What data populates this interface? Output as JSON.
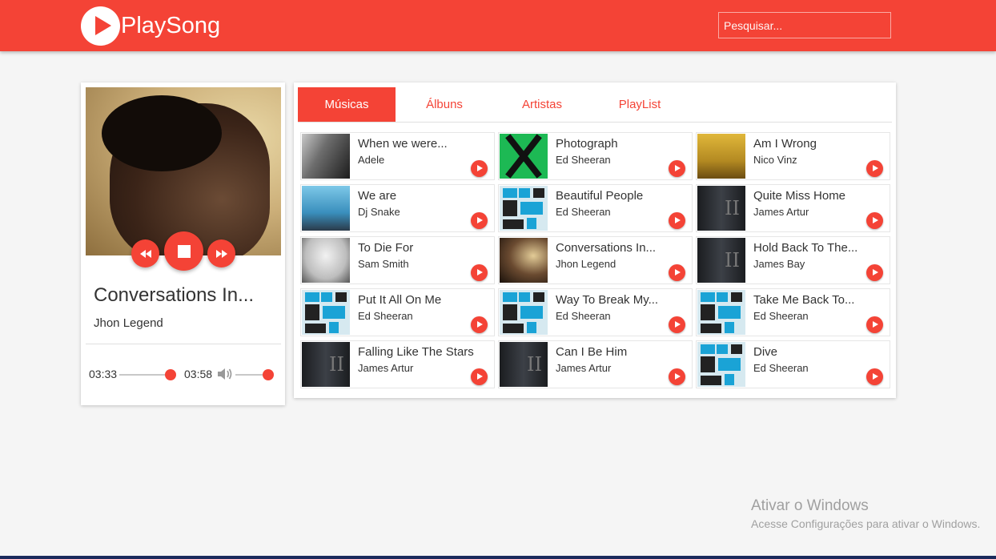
{
  "app": {
    "name": "PlaySong"
  },
  "search": {
    "placeholder": "Pesquisar..."
  },
  "player": {
    "title": "Conversations In...",
    "artist": "Jhon Legend",
    "current_time": "03:33",
    "total_time": "03:58",
    "progress_fraction": 0.89,
    "volume_fraction": 1.0
  },
  "tabs": [
    {
      "label": "Músicas",
      "active": true
    },
    {
      "label": "Álbuns",
      "active": false
    },
    {
      "label": "Artistas",
      "active": false
    },
    {
      "label": "PlayList",
      "active": false
    }
  ],
  "songs": [
    {
      "title": "When we were...",
      "artist": "Adele",
      "thumb": "adele"
    },
    {
      "title": "Photograph",
      "artist": "Ed Sheeran",
      "thumb": "x"
    },
    {
      "title": "Am I Wrong",
      "artist": "Nico Vinz",
      "thumb": "nico"
    },
    {
      "title": "We are",
      "artist": "Dj Snake",
      "thumb": "dj"
    },
    {
      "title": "Beautiful People",
      "artist": "Ed Sheeran",
      "thumb": "divide"
    },
    {
      "title": "Quite Miss Home",
      "artist": "James Artur",
      "thumb": "james"
    },
    {
      "title": "To Die For",
      "artist": "Sam Smith",
      "thumb": "sam"
    },
    {
      "title": "Conversations In...",
      "artist": "Jhon Legend",
      "thumb": "jhon"
    },
    {
      "title": "Hold Back To The...",
      "artist": "James Bay",
      "thumb": "james"
    },
    {
      "title": "Put It All On Me",
      "artist": "Ed Sheeran",
      "thumb": "divide"
    },
    {
      "title": "Way To Break My...",
      "artist": "Ed Sheeran",
      "thumb": "divide"
    },
    {
      "title": "Take Me Back To...",
      "artist": "Ed Sheeran",
      "thumb": "divide"
    },
    {
      "title": "Falling Like The Stars",
      "artist": "James Artur",
      "thumb": "james"
    },
    {
      "title": "Can I Be Him",
      "artist": "James Artur",
      "thumb": "james"
    },
    {
      "title": "Dive",
      "artist": "Ed Sheeran",
      "thumb": "divide"
    }
  ],
  "watermark": {
    "line1": "Ativar o Windows",
    "line2": "Acesse Configurações para ativar o Windows."
  },
  "colors": {
    "accent": "#f44336",
    "background": "#f5f5f5"
  }
}
